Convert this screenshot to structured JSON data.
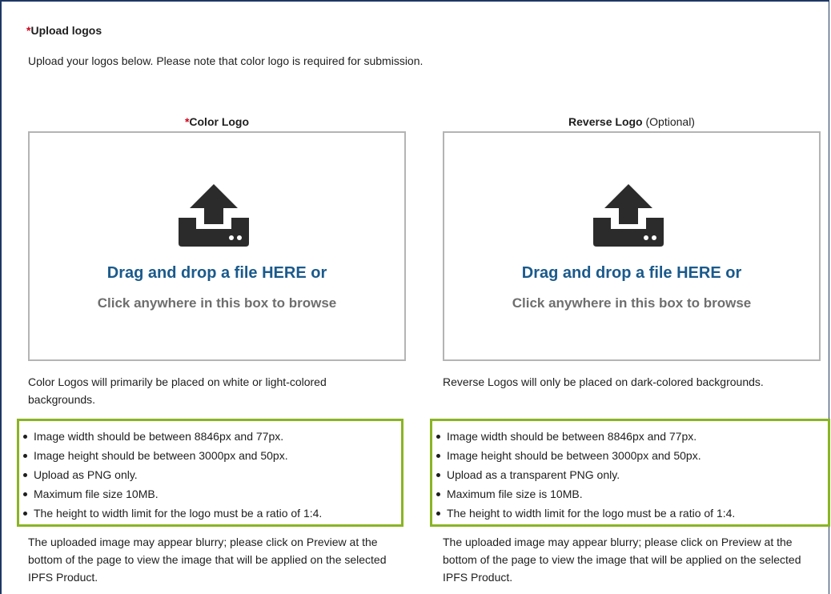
{
  "section": {
    "required_mark": "*",
    "title": "Upload logos",
    "intro": "Upload your logos below. Please note that color logo is required for submission."
  },
  "color_logo": {
    "required_mark": "*",
    "title": "Color Logo",
    "dropzone_main": "Drag and drop a file HERE or",
    "dropzone_sub": "Click anywhere in this box to browse",
    "description": "Color Logos will primarily be placed on white or light-colored backgrounds.",
    "requirements": [
      "Image width should be between 8846px and 77px.",
      "Image height should be between 3000px and 50px.",
      "Upload as PNG only.",
      "Maximum file size 10MB.",
      "The height to width limit for the logo must be a ratio of 1:4."
    ],
    "note": "The uploaded image may appear blurry; please click on Preview at the bottom of the page to view the image that will be applied on the selected IPFS Product."
  },
  "reverse_logo": {
    "title": "Reverse Logo",
    "optional_label": "(Optional)",
    "dropzone_main": "Drag and drop a file HERE or",
    "dropzone_sub": "Click anywhere in this box to browse",
    "description": "Reverse Logos will only be placed on dark-colored backgrounds.",
    "requirements": [
      "Image width should be between 8846px and 77px.",
      "Image height should be between 3000px and 50px.",
      "Upload as a transparent PNG only.",
      "Maximum file size is 10MB.",
      "The height to width limit for the logo must be a ratio of 1:4."
    ],
    "note": "The uploaded image may appear blurry; please click on Preview at the bottom of the page to view the image that will be applied on the selected IPFS Product."
  },
  "icons": {
    "upload": "upload-icon"
  },
  "colors": {
    "required": "#d0021b",
    "link_blue": "#1a5a8c",
    "highlight_border": "#8ab423",
    "frame_border": "#1f3864"
  }
}
